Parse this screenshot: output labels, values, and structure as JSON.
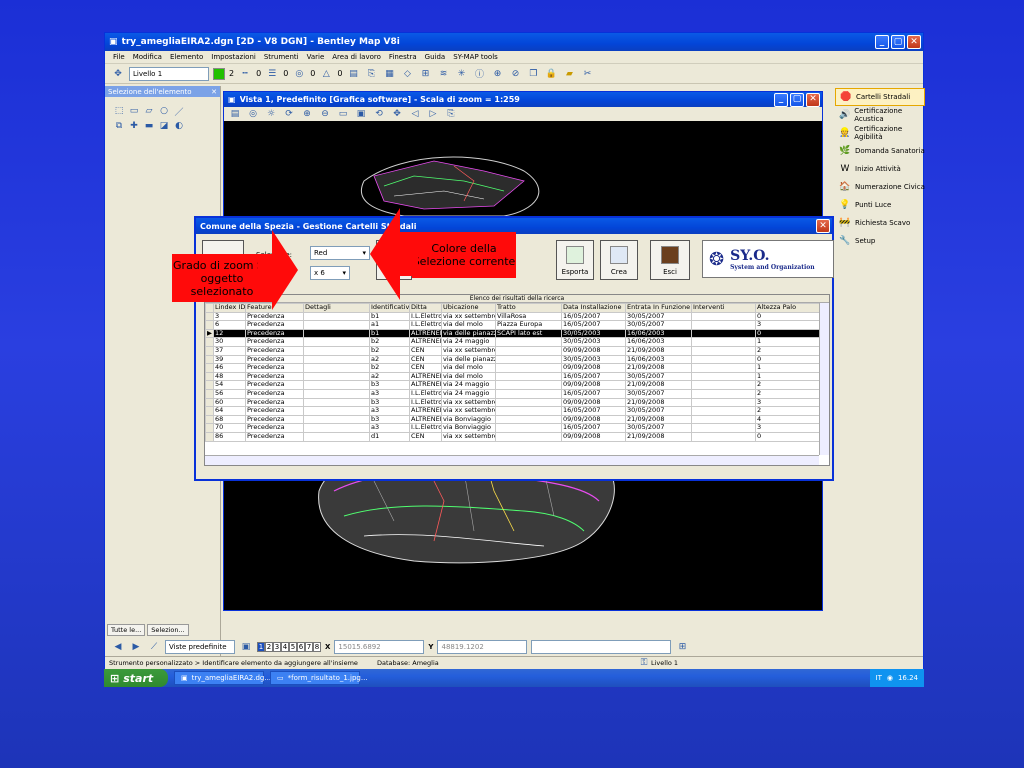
{
  "window": {
    "title": "try_amegliaEIRA2.dgn [2D - V8 DGN] - Bentley Map V8i"
  },
  "menu": [
    "File",
    "Modifica",
    "Elemento",
    "Impostazioni",
    "Strumenti",
    "Varie",
    "Area di lavoro",
    "Finestra",
    "Guida",
    "SY-MAP tools"
  ],
  "toolbar": {
    "level": "Livello 1",
    "color_index": "2",
    "linestyle_index": "0",
    "weight_index": "0",
    "transparency": "0",
    "priority": "0"
  },
  "left_panel": {
    "title": "Selezione dell'elemento"
  },
  "view": {
    "title": "Vista 1, Predefinito [Grafica software] - Scala di zoom = 1:259"
  },
  "right_panel": {
    "items": [
      "Cartelli Stradali",
      "Certificazione Acustica",
      "Certificazione Agibilità",
      "Domanda Sanatoria",
      "Inizio Attività",
      "Numerazione Civica",
      "Punti Luce",
      "Richiesta Scavo",
      "Setup"
    ]
  },
  "dialog": {
    "title": "Comune della Spezia - Gestione Cartelli Stradali",
    "color_label": "Selezione:",
    "color_value": "Red",
    "zoom_value": "x 6",
    "buttons": {
      "export": "Esporta",
      "create": "Crea",
      "exit": "Esci"
    },
    "logo_main": "SY.O.",
    "logo_sub": "System and Organization",
    "grid_caption": "Elenco dei risultati della ricerca",
    "columns": [
      "Lindex ID",
      "Feature",
      "Dettagli",
      "Identificativo",
      "Ditta",
      "Ubicazione",
      "Tratto",
      "Data Installazione",
      "Entrata In Funzione",
      "Interventi",
      "Altezza Palo"
    ],
    "rows": [
      [
        "3",
        "Precedenza",
        "",
        "b1",
        "I.L.Elettro",
        "via xx settembre",
        "VillaRosa",
        "16/05/2007",
        "30/05/2007",
        "",
        "0"
      ],
      [
        "6",
        "Precedenza",
        "",
        "a1",
        "I.L.Elettro",
        "via del molo",
        "Piazza Europa",
        "16/05/2007",
        "30/05/2007",
        "",
        "3"
      ],
      [
        "12",
        "Precedenza",
        "",
        "b1",
        "ALTRENER",
        "via delle pianazze",
        "SCAPI lato est",
        "30/05/2003",
        "16/06/2003",
        "",
        "0"
      ],
      [
        "30",
        "Precedenza",
        "",
        "b2",
        "ALTRENER",
        "via 24 maggio",
        "",
        "30/05/2003",
        "16/06/2003",
        "",
        "1"
      ],
      [
        "37",
        "Precedenza",
        "",
        "b2",
        "CEN",
        "via xx settembre",
        "",
        "09/09/2008",
        "21/09/2008",
        "",
        "2"
      ],
      [
        "39",
        "Precedenza",
        "",
        "a2",
        "CEN",
        "via delle pianazze",
        "",
        "30/05/2003",
        "16/06/2003",
        "",
        "0"
      ],
      [
        "46",
        "Precedenza",
        "",
        "b2",
        "CEN",
        "via del molo",
        "",
        "09/09/2008",
        "21/09/2008",
        "",
        "1"
      ],
      [
        "48",
        "Precedenza",
        "",
        "a2",
        "ALTRENER",
        "via del molo",
        "",
        "16/05/2007",
        "30/05/2007",
        "",
        "1"
      ],
      [
        "54",
        "Precedenza",
        "",
        "b3",
        "ALTRENER",
        "via 24 maggio",
        "",
        "09/09/2008",
        "21/09/2008",
        "",
        "2"
      ],
      [
        "56",
        "Precedenza",
        "",
        "a3",
        "I.L.Elettro",
        "via 24 maggio",
        "",
        "16/05/2007",
        "30/05/2007",
        "",
        "2"
      ],
      [
        "60",
        "Precedenza",
        "",
        "b3",
        "I.L.Elettro",
        "via xx settembre",
        "",
        "09/09/2008",
        "21/09/2008",
        "",
        "3"
      ],
      [
        "64",
        "Precedenza",
        "",
        "a3",
        "ALTRENER",
        "via xx settembre",
        "",
        "16/05/2007",
        "30/05/2007",
        "",
        "2"
      ],
      [
        "68",
        "Precedenza",
        "",
        "b3",
        "ALTRENER",
        "via Bonviaggio",
        "",
        "09/09/2008",
        "21/09/2008",
        "",
        "4"
      ],
      [
        "70",
        "Precedenza",
        "",
        "a3",
        "I.L.Elettro",
        "via Bonviaggio",
        "",
        "16/05/2007",
        "30/05/2007",
        "",
        "3"
      ],
      [
        "86",
        "Precedenza",
        "",
        "d1",
        "CEN",
        "via xx settembre",
        "",
        "09/09/2008",
        "21/09/2008",
        "",
        "0"
      ]
    ],
    "selected_row": 2
  },
  "callouts": {
    "zoom": "Grado di zoom Su oggetto selezionato",
    "color": "Colore della Selezione corrente"
  },
  "bottom": {
    "tab1": "Tutte le...",
    "tab2": "Selezion...",
    "views_label": "Viste predefinite",
    "pages": [
      "1",
      "2",
      "3",
      "4",
      "5",
      "6",
      "7",
      "8"
    ],
    "x_label": "X",
    "x_value": "15015.6892",
    "y_label": "Y",
    "y_value": "48819.1202",
    "status_left": "Strumento personalizzato > Identificare elemento da aggiungere all'insieme",
    "status_db": "Database: Ameglia",
    "status_level": "Livello 1"
  },
  "taskbar": {
    "start": "start",
    "item1": "try_amegliaEIRA2.dg...",
    "item2": "*form_risultato_1.jpg...",
    "lang": "IT",
    "clock": "16.24"
  }
}
